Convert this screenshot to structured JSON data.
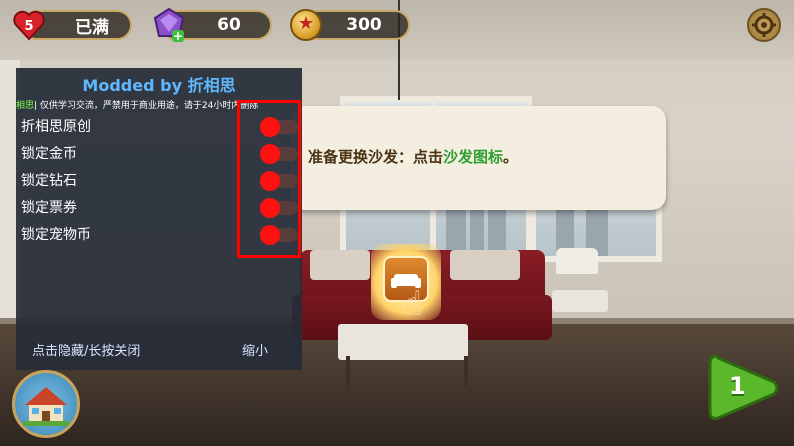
{
  "hud": {
    "lives": "5",
    "lives_status": "已满",
    "gems": "60",
    "coins": "300"
  },
  "mod_menu": {
    "title": "Modded by 折相思",
    "notice_prefix": "相思",
    "notice": "| 仅供学习交流，严禁用于商业用途，请于24小时内删除",
    "items": [
      {
        "label": "折相思原创",
        "enabled": true
      },
      {
        "label": "锁定金币",
        "enabled": true
      },
      {
        "label": "锁定钻石",
        "enabled": true
      },
      {
        "label": "锁定票券",
        "enabled": true
      },
      {
        "label": "锁定宠物币",
        "enabled": true
      }
    ],
    "hide_label": "点击隐藏/长按关闭",
    "minimize_label": "缩小"
  },
  "dialog": {
    "text_before": "准备更换沙发：点击",
    "text_highlight": "沙发图标",
    "text_after": "。"
  },
  "level_button": {
    "label": "1"
  },
  "colors": {
    "accent_blue": "#5fb8ff",
    "toggle_on": "#ff1111",
    "highlight_green": "#2f9e2f",
    "play_green": "#5ab82a"
  },
  "icons": [
    "heart-icon",
    "gem-icon",
    "coin-icon",
    "gear-icon",
    "sofa-icon",
    "pointing-hand-icon",
    "house-icon",
    "play-arrow-icon"
  ]
}
